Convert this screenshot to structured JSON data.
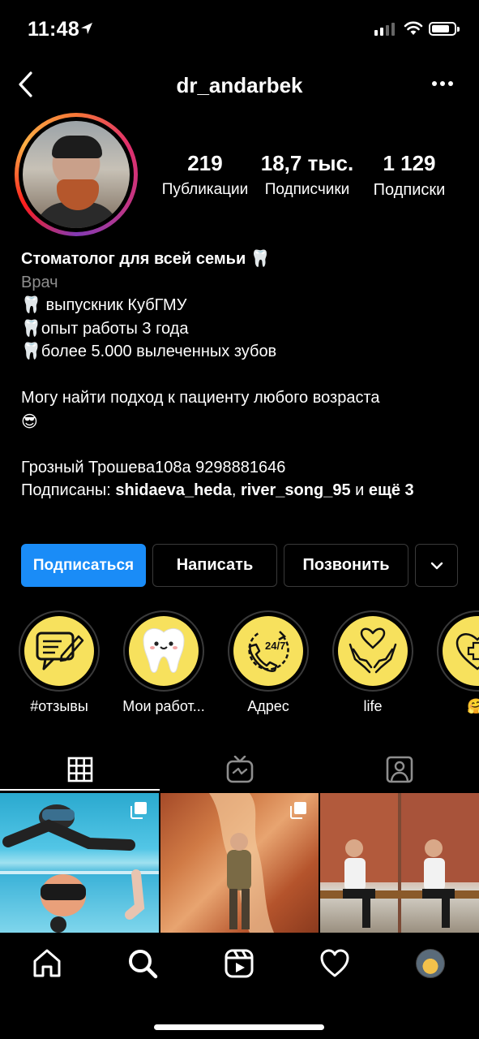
{
  "status_bar": {
    "time": "11:48"
  },
  "header": {
    "username": "dr_andarbek"
  },
  "stats": [
    {
      "value": "219",
      "label": "Публикации"
    },
    {
      "value": "18,7 тыс.",
      "label": "Подписчики"
    },
    {
      "value": "1 129",
      "label": "Подписки"
    }
  ],
  "bio": {
    "name": "Стоматолог для всей семьи 🦷",
    "category": "Врач",
    "line1": "🦷 выпускник КубГМУ",
    "line2": "🦷опыт работы 3 года",
    "line3": "🦷более 5.000 вылеченных зубов",
    "line4": "Могу найти подход к пациенту любого возраста",
    "line5": "😎",
    "address": "Грозный Трошева108а 9298881646",
    "followed_prefix": "Подписаны: ",
    "followed_user1": "shidaeva_heda",
    "followed_sep": ", ",
    "followed_user2": "river_song_95",
    "followed_and": " и ",
    "followed_more": "ещё 3"
  },
  "buttons": {
    "follow": "Подписаться",
    "message": "Написать",
    "call": "Позвонить"
  },
  "highlights": [
    {
      "label": "#отзывы",
      "icon": "chat-pencil-icon"
    },
    {
      "label": "Мои работ...",
      "icon": "tooth-face-icon"
    },
    {
      "label": "Адрес",
      "icon": "phone-24-7-icon"
    },
    {
      "label": "life",
      "icon": "hands-heart-icon"
    },
    {
      "label": "🤗",
      "icon": "medical-heart-icon"
    }
  ],
  "tabs": [
    "grid-icon",
    "igtv-icon",
    "tagged-icon"
  ],
  "bottom_nav": [
    "home-icon",
    "search-icon",
    "reels-icon",
    "heart-icon",
    "profile-avatar"
  ],
  "colors": {
    "follow_button": "#1a8cf7",
    "highlight_bg": "#f7e15d"
  }
}
